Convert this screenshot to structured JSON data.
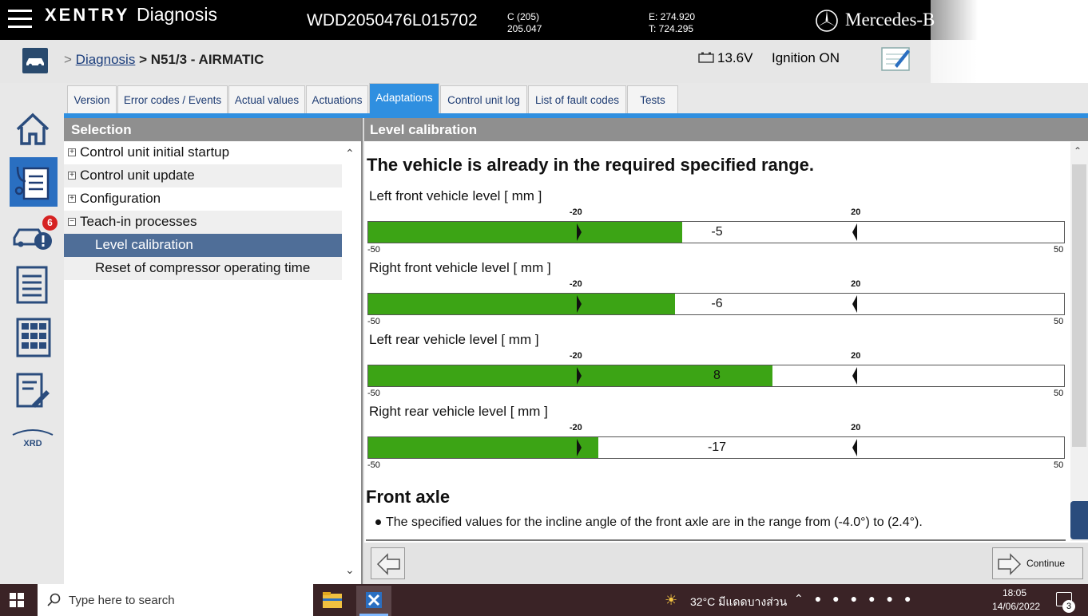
{
  "header": {
    "brand": "XENTRY",
    "product": "Diagnosis",
    "vin": "WDD2050476L015702",
    "model_line1": "C (205)",
    "model_line2": "205.047",
    "odo_line1": "E: 274.920",
    "odo_line2": "T: 724.295",
    "make": "Mercedes-B"
  },
  "breadcrumb": {
    "prefix": ">",
    "link": "Diagnosis",
    "current": "> N51/3 - AIRMATIC"
  },
  "status": {
    "voltage": "13.6V",
    "ignition": "Ignition ON"
  },
  "sidebar": {
    "fault_badge": "6",
    "xrd_label": "XRD"
  },
  "tabs": [
    {
      "label": "Version"
    },
    {
      "label": "Error codes / Events"
    },
    {
      "label": "Actual values"
    },
    {
      "label": "Actuations"
    },
    {
      "label": "Adaptations"
    },
    {
      "label": "Control unit log"
    },
    {
      "label": "List of fault codes"
    },
    {
      "label": "Tests"
    }
  ],
  "active_tab": "Adaptations",
  "selection": {
    "title": "Selection",
    "items": [
      {
        "label": "Control unit initial startup",
        "expander": "+"
      },
      {
        "label": "Control unit update",
        "expander": "+"
      },
      {
        "label": "Configuration",
        "expander": "+"
      },
      {
        "label": "Teach-in processes",
        "expander": "−"
      },
      {
        "label": "Level calibration"
      },
      {
        "label": "Reset of compressor operating time"
      }
    ]
  },
  "main": {
    "title": "Level calibration",
    "headline": "The vehicle is already in the required specified range.",
    "gauges": [
      {
        "label": "Left front vehicle level [ mm ]",
        "value": -5,
        "value_text": "-5"
      },
      {
        "label": "Right front vehicle level [ mm ]",
        "value": -6,
        "value_text": "-6"
      },
      {
        "label": "Left rear vehicle level [ mm ]",
        "value": 8,
        "value_text": "8"
      },
      {
        "label": "Right rear vehicle level [ mm ]",
        "value": -17,
        "value_text": "-17"
      }
    ],
    "gauge_scale": {
      "min": -50,
      "max": 50,
      "lower_limit": -20,
      "upper_limit": 20,
      "min_text": "-50",
      "max_text": "50",
      "lower_text": "-20",
      "upper_text": "20"
    },
    "section_title": "Front axle",
    "section_text": "The specified values for the incline angle of the front axle are in the range from (-4.0°) to (2.4°).",
    "continue_label": "Continue"
  },
  "taskbar": {
    "search_placeholder": "Type here to search",
    "weather": "32°C มีแดดบางส่วน",
    "time": "18:05",
    "date": "14/06/2022",
    "notifications": "3"
  },
  "colors": {
    "accent": "#2f8fe0",
    "gauge_fill": "#3ca415",
    "selected_row": "#4f6e98",
    "panel_header": "#8f8f8f"
  }
}
